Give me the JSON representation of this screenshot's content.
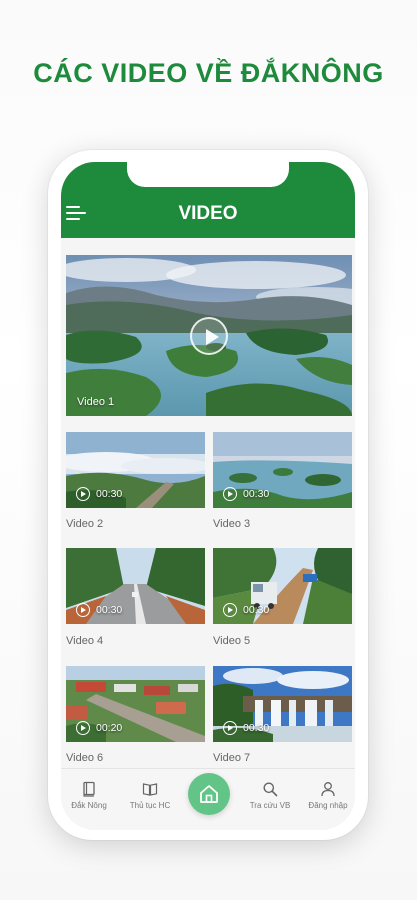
{
  "headline": "CÁC VIDEO VỀ ĐẮKNÔNG",
  "appbar": {
    "title": "VIDEO",
    "color": "#1e8a3c"
  },
  "featured": {
    "label": "Video 1"
  },
  "videos": [
    {
      "title": "Video 2",
      "duration": "00:30"
    },
    {
      "title": "Video 3",
      "duration": "00:30"
    },
    {
      "title": "Video 4",
      "duration": "00:30"
    },
    {
      "title": "Video 5",
      "duration": "00:30"
    },
    {
      "title": "Video 6",
      "duration": "00:20"
    },
    {
      "title": "Video 7",
      "duration": "00:30"
    }
  ],
  "bottom_nav": [
    {
      "label": "Đắk Nông",
      "icon": "book-icon"
    },
    {
      "label": "Thủ tục HC",
      "icon": "open-book-icon"
    },
    {
      "label": "",
      "icon": "home-icon"
    },
    {
      "label": "Tra cứu VB",
      "icon": "search-icon"
    },
    {
      "label": "Đăng nhập",
      "icon": "user-icon"
    }
  ],
  "colors": {
    "brand_green": "#1e8a3c",
    "home_button": "#63c488"
  }
}
